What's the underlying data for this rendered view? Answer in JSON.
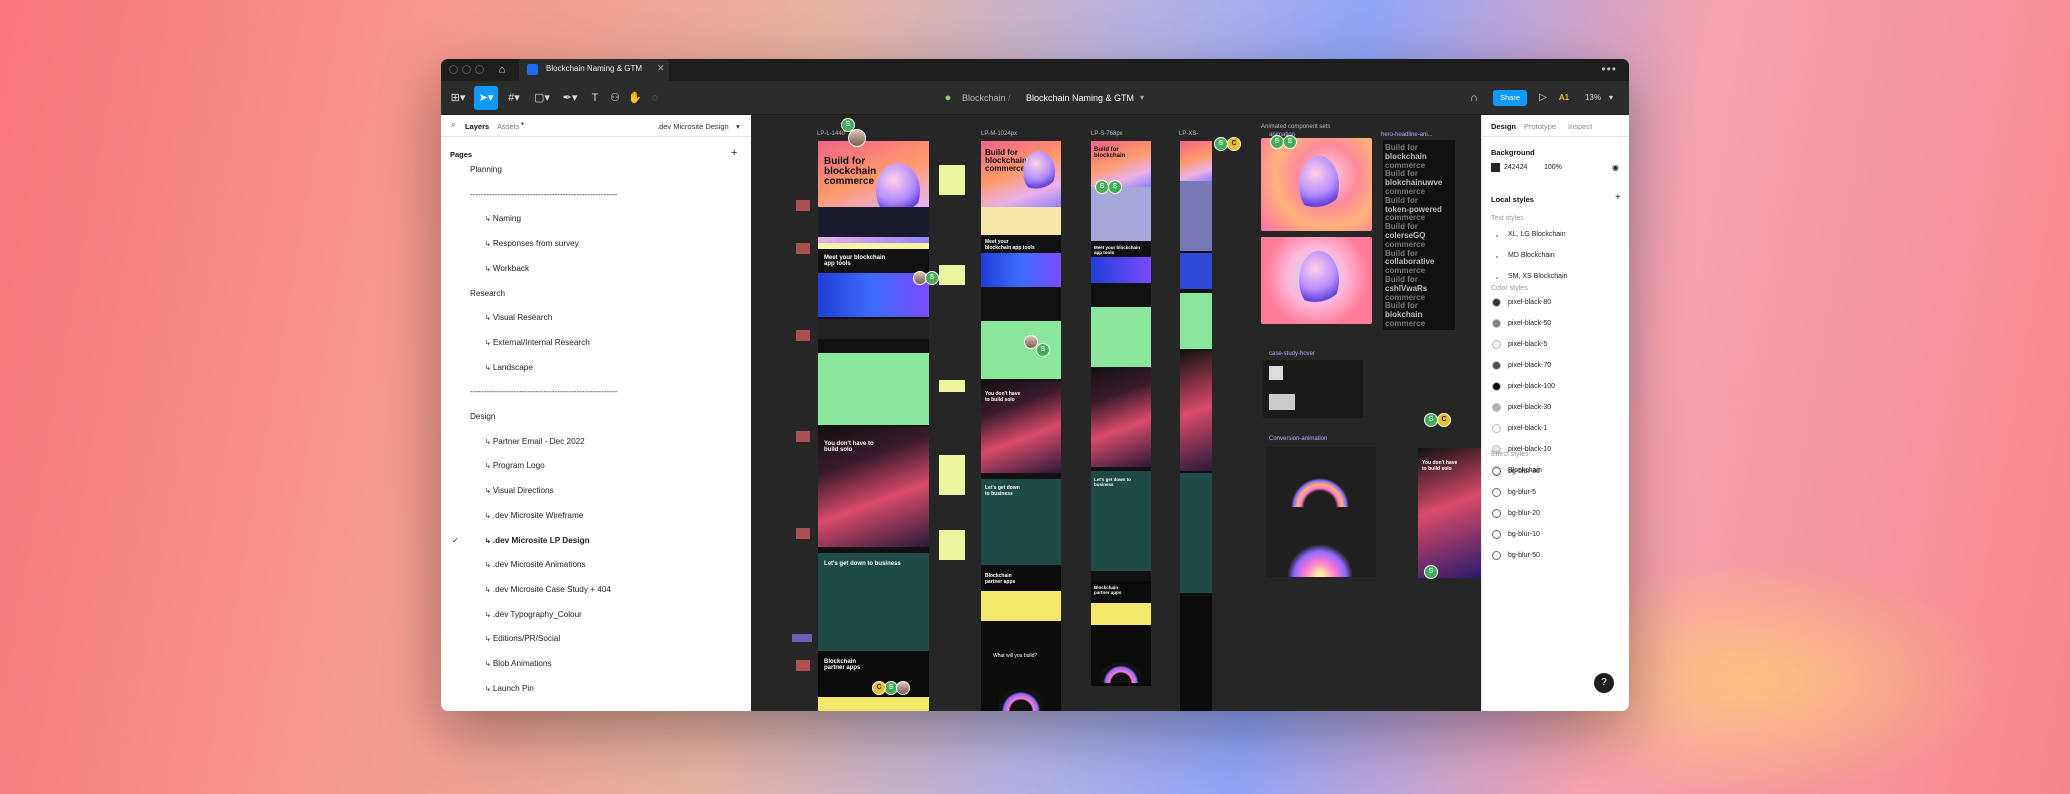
{
  "window": {
    "tab_title": "Blockchain Naming & GTM",
    "more_label": "•••"
  },
  "toolbar": {
    "crumb_project": "Blockchain",
    "crumb_separator": "/",
    "crumb_file": "Blockchain Naming & GTM",
    "share_label": "Share",
    "user_initials": "A1",
    "zoom": "13%"
  },
  "left_panel": {
    "tab_layers": "Layers",
    "tab_assets": "Assets",
    "current_page": ".dev Microsite Design",
    "pages_header": "Pages",
    "pages": [
      {
        "label": "Planning",
        "indent": false
      },
      {
        "label": "------------------------------------------------------",
        "indent": false
      },
      {
        "label": "Naming",
        "indent": true
      },
      {
        "label": "Responses from survey",
        "indent": true
      },
      {
        "label": "Workback",
        "indent": true
      },
      {
        "label": "Research",
        "indent": false
      },
      {
        "label": "Visual Research",
        "indent": true
      },
      {
        "label": "External/Internal Research",
        "indent": true
      },
      {
        "label": "Landscape",
        "indent": true
      },
      {
        "label": "------------------------------------------------------",
        "indent": false
      },
      {
        "label": "Design",
        "indent": false
      },
      {
        "label": "Partner Email - Dec 2022",
        "indent": true
      },
      {
        "label": "Program Logo",
        "indent": true
      },
      {
        "label": "Visual Directions",
        "indent": true
      },
      {
        "label": ".dev Microsite Wireframe",
        "indent": true
      },
      {
        "label": ".dev Microsite LP Design",
        "indent": true,
        "selected": true
      },
      {
        "label": ".dev Microsite Animations",
        "indent": true
      },
      {
        "label": ".dev Microsite Case Study + 404",
        "indent": true
      },
      {
        "label": ".dev Typography_Colour",
        "indent": true
      },
      {
        "label": "Editions/PR/Social",
        "indent": true
      },
      {
        "label": "Blob Animations",
        "indent": true
      },
      {
        "label": "Launch Pin",
        "indent": true
      }
    ]
  },
  "canvas": {
    "frames": [
      {
        "label": "LP-L-1440"
      },
      {
        "label": "LP-M-1024px"
      },
      {
        "label": "LP-S-768px"
      },
      {
        "label": "LP-XS-"
      }
    ],
    "animated_sets_label": "Animated component sets",
    "animation_label": "animation",
    "hero_headline_label": "hero-headline-ani...",
    "case_study_label": "case-study-hover",
    "conversion_label": "Conversion-animation",
    "hero_title": "Build for blockchain commerce",
    "hero_title_short": "Build for blockchain",
    "section_apps": "Meet your blockchain app tools",
    "section_dont": "You don't have to build solo",
    "section_business": "Let's get down to business",
    "section_partner": "Blockchain partner apps",
    "section_what": "What will you build?",
    "headline_stack": [
      "Build for",
      "blockchain",
      "commerce",
      "Build for",
      "blokchainuwve",
      "commerce",
      "Build for",
      "token-powered",
      "commerce",
      "Build for",
      "colerseGQ",
      "commerce",
      "Build for",
      "collaborative",
      "commerce",
      "Build for",
      "cshlVwaRs",
      "commerce",
      "Build for",
      "blokchain",
      "commerce"
    ],
    "avatar_labels": {
      "s": "S",
      "c": "C"
    }
  },
  "right_panel": {
    "tabs": [
      "Design",
      "Prototype",
      "Inspect"
    ],
    "background_header": "Background",
    "background_hex": "242424",
    "background_opacity": "100%",
    "local_styles_header": "Local styles",
    "text_styles_header": "Text styles",
    "text_styles": [
      "XL, LG Blockchain",
      "MD Blockchain",
      "SM, XS Blockchain"
    ],
    "color_styles_header": "Color styles",
    "color_styles": [
      {
        "name": "pixel-black-80",
        "color": "#333333"
      },
      {
        "name": "pixel-black-50",
        "color": "#808080"
      },
      {
        "name": "pixel-black-5",
        "color": "#f2f2f2"
      },
      {
        "name": "pixel-black-70",
        "color": "#4d4d4d"
      },
      {
        "name": "pixel-black-100",
        "color": "#000000"
      },
      {
        "name": "pixel-black-30",
        "color": "#b3b3b3"
      },
      {
        "name": "pixel-black-1",
        "color": "#fcfcfc"
      },
      {
        "name": "pixel-black-10",
        "color": "#e6e6e6"
      },
      {
        "name": "Blockchain",
        "color": "#ffffff"
      }
    ],
    "effect_styles_header": "Effect styles",
    "effect_styles": [
      "bg-blur-30",
      "bg-blur-5",
      "bg-blur-20",
      "bg-blur-10",
      "bg-blur-50"
    ],
    "help_label": "?"
  }
}
